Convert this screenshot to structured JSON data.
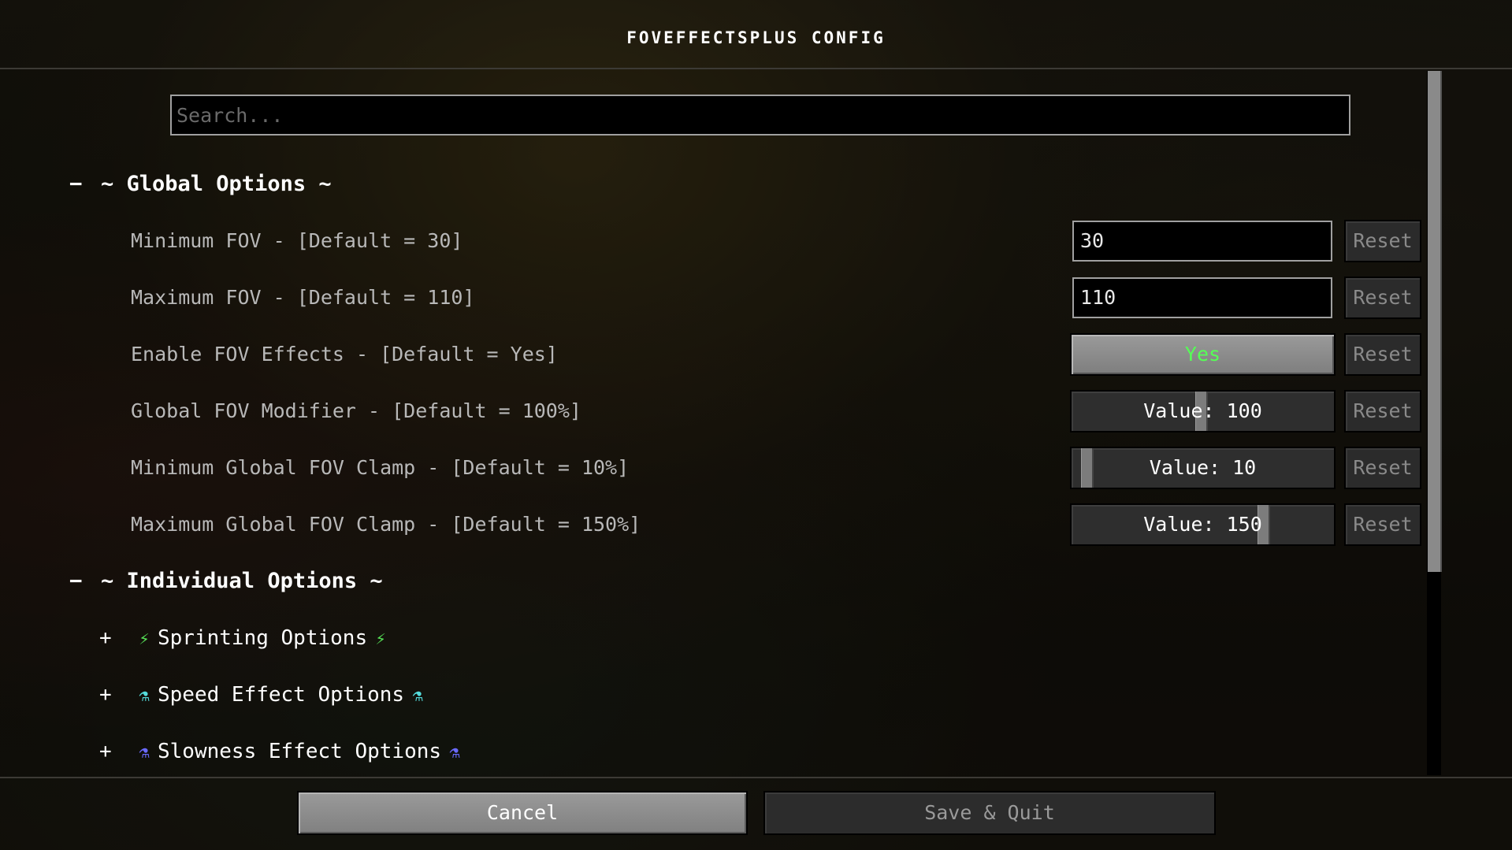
{
  "header": {
    "title": "FOVEFFECTSPLUS CONFIG"
  },
  "search": {
    "placeholder": "Search..."
  },
  "global_section": {
    "toggle": "−",
    "title": "~ Global Options ~"
  },
  "options": [
    {
      "label": "Minimum FOV - [Default = 30]",
      "control": "field",
      "value": "30",
      "reset_label": "Reset"
    },
    {
      "label": "Maximum FOV - [Default = 110]",
      "control": "field",
      "value": "110",
      "reset_label": "Reset"
    },
    {
      "label": "Enable FOV Effects - [Default = Yes]",
      "control": "toggle",
      "value": "Yes",
      "value_color": "#55ff55",
      "reset_label": "Reset"
    },
    {
      "label": "Global FOV Modifier - [Default = 100%]",
      "control": "slider",
      "value": "Value: 100",
      "reset_label": "Reset"
    },
    {
      "label": "Minimum Global FOV Clamp - [Default = 10%]",
      "control": "slider",
      "value": "Value: 10",
      "reset_label": "Reset"
    },
    {
      "label": "Maximum Global FOV Clamp - [Default = 150%]",
      "control": "slider",
      "value": "Value: 150",
      "reset_label": "Reset"
    }
  ],
  "individual_section": {
    "toggle": "−",
    "title": "~ Individual Options ~"
  },
  "subsections": [
    {
      "toggle": "+",
      "label": "Sprinting Options",
      "icon": "sprint-icon",
      "icon_glyph": "⚡",
      "icon_color": "#55dd55"
    },
    {
      "toggle": "+",
      "label": "Speed Effect Options",
      "icon": "potion-icon",
      "icon_glyph": "⚗",
      "icon_color": "#55dddd"
    },
    {
      "toggle": "+",
      "label": "Slowness Effect Options",
      "icon": "potion-icon",
      "icon_glyph": "⚗",
      "icon_color": "#6a6aff"
    }
  ],
  "footer": {
    "cancel_label": "Cancel",
    "save_label": "Save & Quit"
  }
}
